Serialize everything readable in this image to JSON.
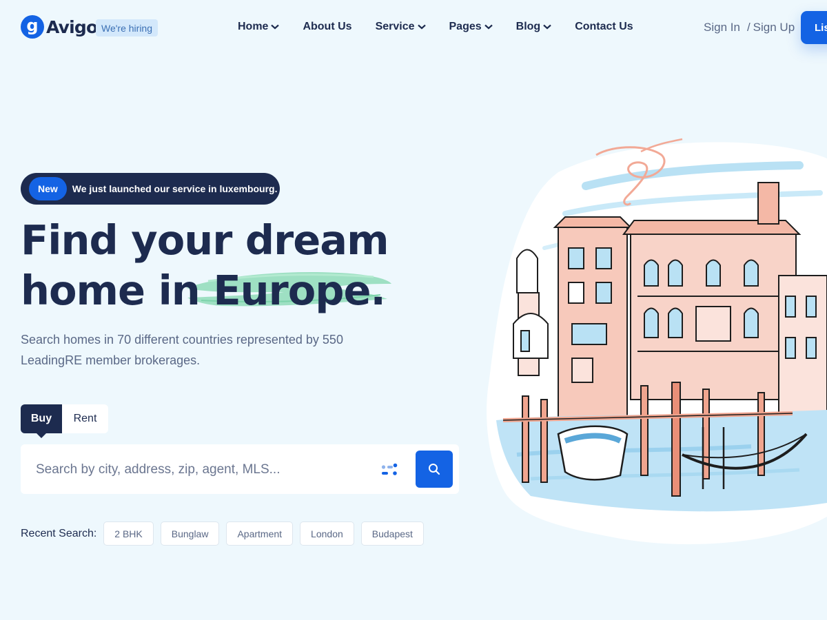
{
  "header": {
    "logo_glyph": "g",
    "logo_text": "Avigo",
    "hiring_badge": "We're hiring",
    "nav": [
      {
        "label": "Home",
        "has_dropdown": true
      },
      {
        "label": "About Us",
        "has_dropdown": false
      },
      {
        "label": "Service",
        "has_dropdown": true
      },
      {
        "label": "Pages",
        "has_dropdown": true
      },
      {
        "label": "Blog",
        "has_dropdown": true
      },
      {
        "label": "Contact Us",
        "has_dropdown": false
      }
    ],
    "sign_in": "Sign In",
    "separator": "/",
    "sign_up": "Sign Up",
    "cta_label": "List"
  },
  "hero": {
    "announcement": {
      "pill": "New",
      "text": "We just launched our service in luxembourg."
    },
    "title_line1": "Find your dream",
    "title_line2": "home in Europe.",
    "description": "Search homes in 70 different countries represented by 550 LeadingRE member brokerages.",
    "tabs": [
      {
        "label": "Buy",
        "active": true
      },
      {
        "label": "Rent",
        "active": false
      }
    ],
    "search": {
      "placeholder": "Search by city, address, zip, agent, MLS...",
      "value": ""
    },
    "recent_label": "Recent Search:",
    "recent": [
      "2 BHK",
      "Bunglaw",
      "Apartment",
      "London",
      "Budapest"
    ]
  },
  "colors": {
    "accent": "#1463e4",
    "navy": "#1d2b4f",
    "background": "#eef8fd",
    "brush": "#8fdcb8"
  },
  "icons": {
    "chevron": "chevron-down-icon",
    "filter": "filter-icon",
    "search": "search-icon"
  }
}
